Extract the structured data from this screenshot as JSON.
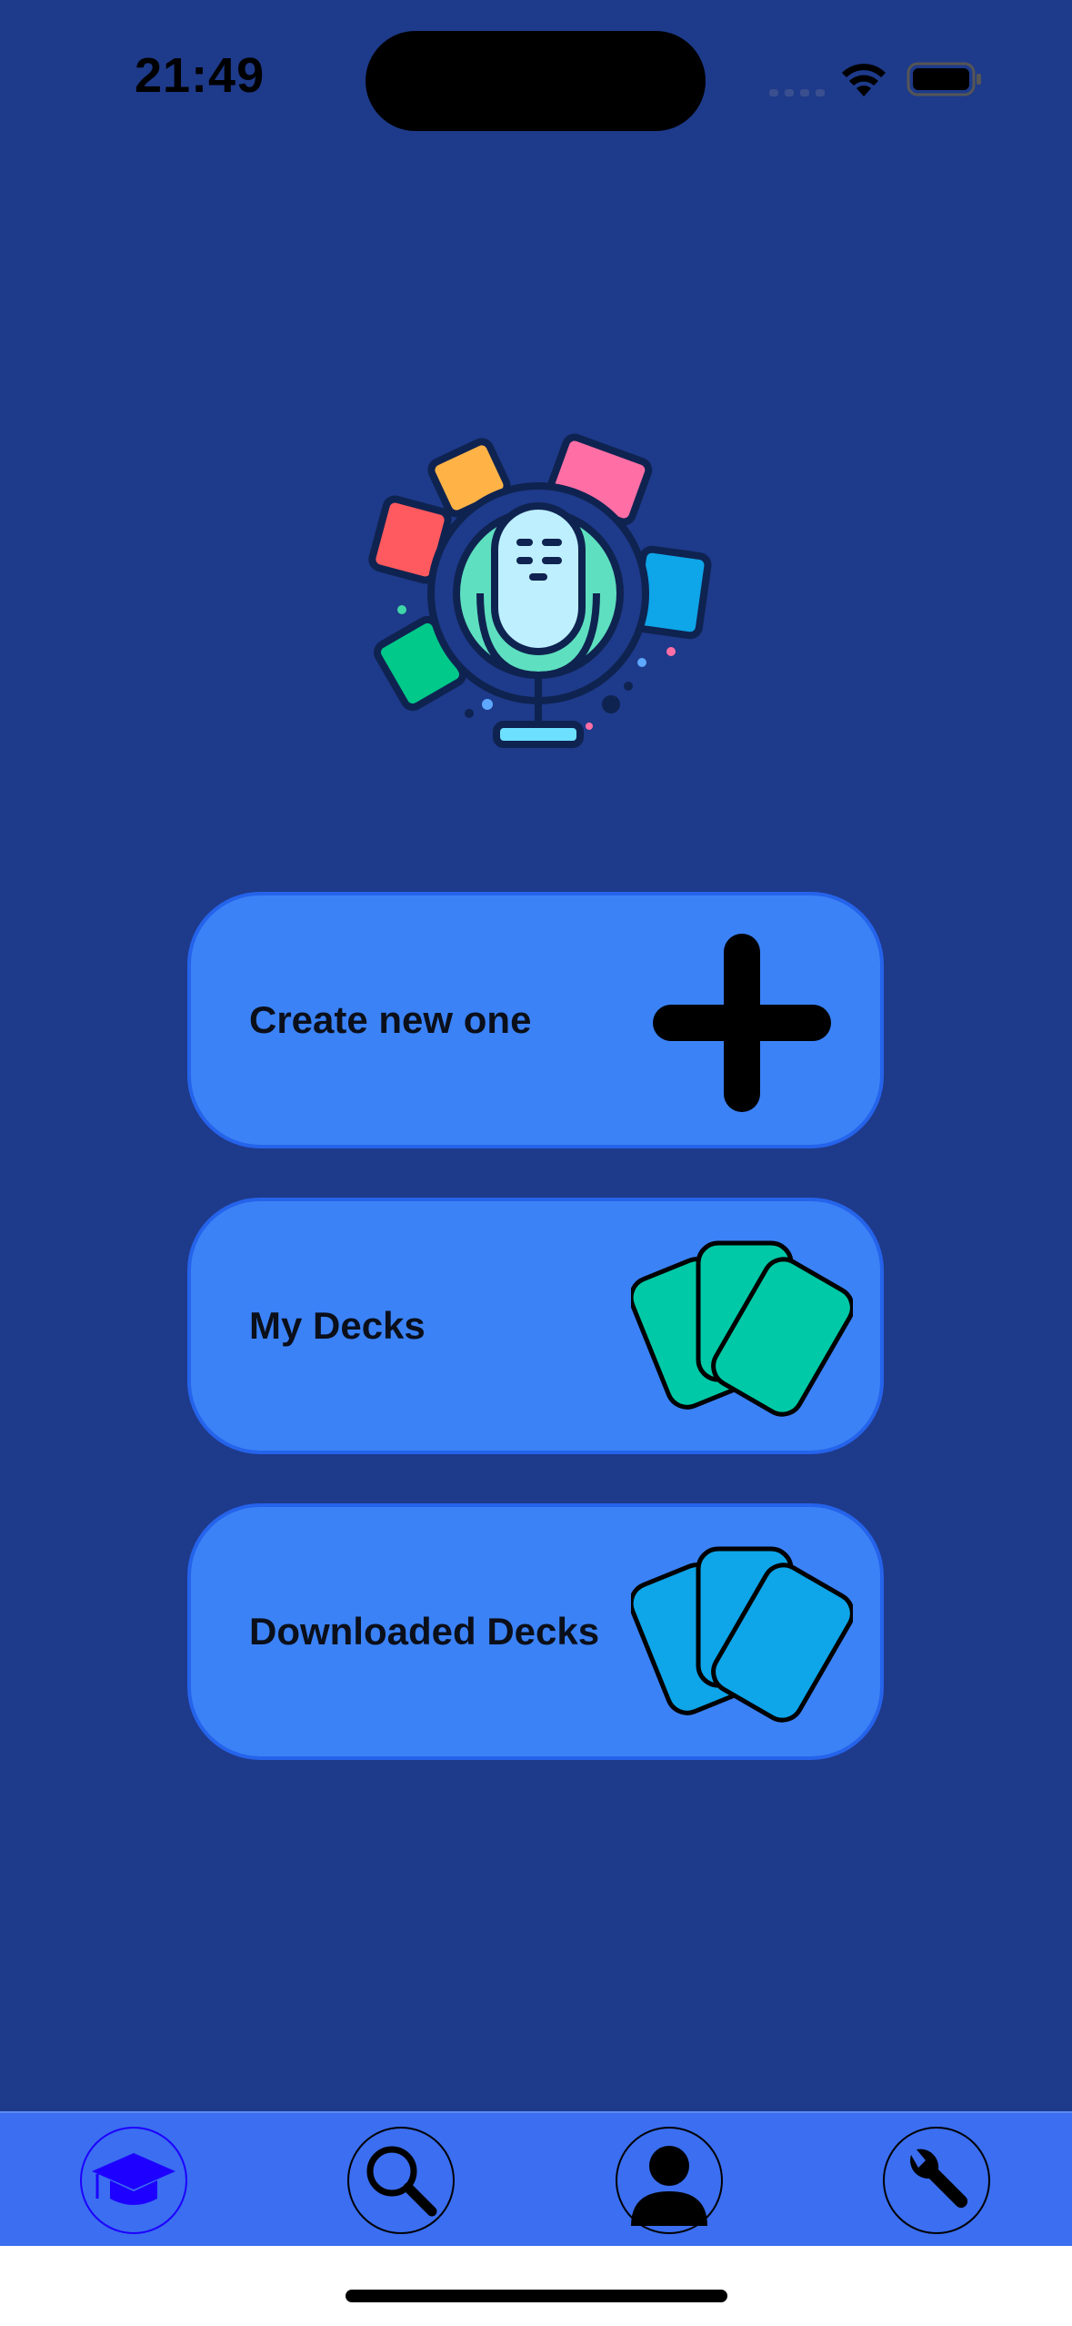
{
  "status_bar": {
    "time": "21:49",
    "icons": [
      "cellular-signal-icon",
      "wifi-icon",
      "battery-icon"
    ]
  },
  "logo": {
    "icon": "microphone-cards-logo"
  },
  "menu": [
    {
      "label": "Create new one",
      "icon": "plus-icon"
    },
    {
      "label": "My Decks",
      "icon": "cards-icon",
      "color": "#00c9a7"
    },
    {
      "label": "Downloaded Decks",
      "icon": "cards-icon",
      "color": "#0ea5e9"
    }
  ],
  "tabs": [
    {
      "icon": "graduation-cap-icon",
      "active": true
    },
    {
      "icon": "search-icon",
      "active": false
    },
    {
      "icon": "profile-icon",
      "active": false
    },
    {
      "icon": "wrench-icon",
      "active": false
    }
  ],
  "colors": {
    "background": "#1e3a8a",
    "button": "#3b82f6",
    "tab_bar": "#3b6ef0",
    "active_tab": "#1d00ff"
  }
}
